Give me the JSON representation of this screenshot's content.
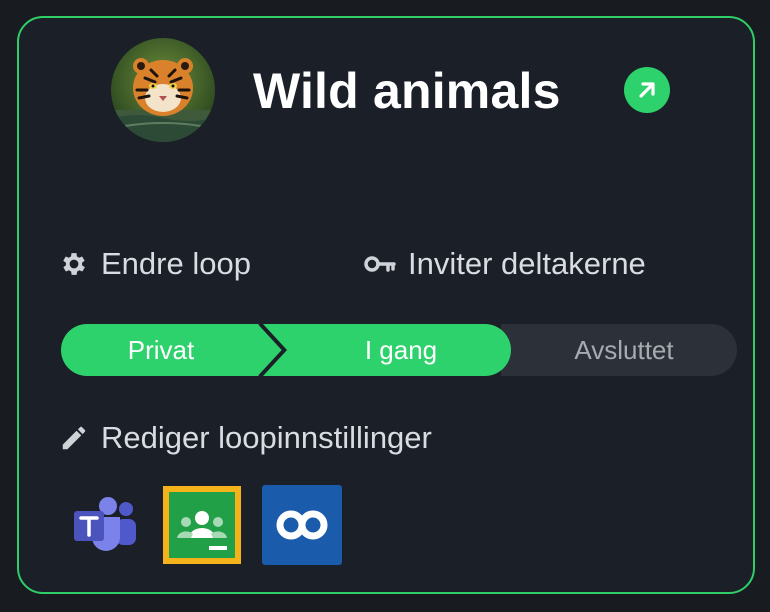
{
  "loop": {
    "title": "Wild animals",
    "avatar_icon": "tiger-photo"
  },
  "actions": {
    "edit_label": "Endre loop",
    "invite_label": "Inviter deltakerne",
    "settings_label": "Rediger loopinnstillinger"
  },
  "status": {
    "steps": [
      {
        "label": "Privat",
        "state": "completed"
      },
      {
        "label": "I gang",
        "state": "active"
      },
      {
        "label": "Avsluttet",
        "state": "upcoming"
      }
    ]
  },
  "integrations": [
    {
      "name": "microsoft-teams-icon"
    },
    {
      "name": "google-classroom-icon",
      "selected": true
    },
    {
      "name": "loop-infinity-icon"
    }
  ],
  "colors": {
    "accent": "#2ed26c",
    "card_bg": "#1b1f27",
    "page_bg": "#181b20",
    "border": "#2fce66",
    "inactive_step": "#2c3038"
  }
}
